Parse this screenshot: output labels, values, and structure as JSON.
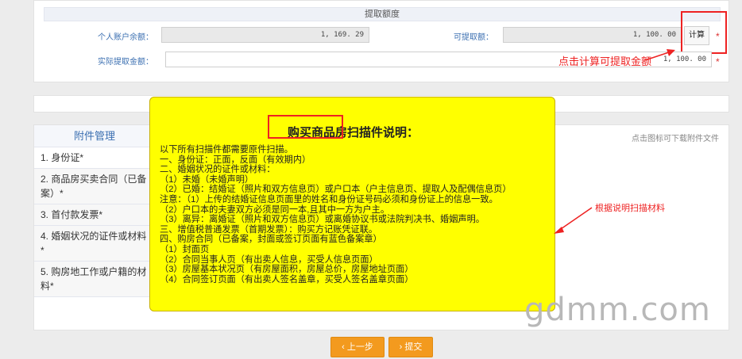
{
  "withdraw": {
    "section_title": "提取额度",
    "personal_balance_label": "个人账户余额：",
    "personal_balance_value": "1, 169. 29",
    "available_label": "可提取额：",
    "available_value": "1, 100. 00",
    "calc_button": "计算",
    "actual_label": "实际提取金额：",
    "actual_value": "1, 100. 00",
    "required_mark": "*"
  },
  "annotations": {
    "calc_note": "点击计算可提取金额",
    "scan_note": "根据说明扫描材料",
    "watermark": "gdmm.com",
    "accent_color": "#e22222"
  },
  "attachments": {
    "title": "附件管理",
    "download_hint": "点击图标可下载附件文件",
    "items": [
      {
        "label": "1. 身份证",
        "req": "*"
      },
      {
        "label": "2. 商品房买卖合同（已备案）",
        "req": "*"
      },
      {
        "label": "3. 首付款发票",
        "req": "*"
      },
      {
        "label": "4. 婚姻状况的证件或材料",
        "req": "*"
      },
      {
        "label": "5. 购房地工作或户籍的材料",
        "req": "*"
      }
    ]
  },
  "instructions": {
    "title": "购买商品房扫描件说明：",
    "lines": [
      "以下所有扫描件都需要原件扫描。",
      "一、身份证：正面，反面（有效期内）",
      "二、婚姻状况的证件或材料：",
      "（1）未婚（未婚声明）",
      "（2）已婚：结婚证（照片和双方信息页）或户口本（户主信息页、提取人及配偶信息页）",
      "注意：（1）上传的结婚证信息页面里的姓名和身份证号码必须和身份证上的信息一致。",
      "（2）户口本的夫妻双方必须是同一本,且其中一方为户主。",
      "（3）离异：离婚证（照片和双方信息页）或离婚协议书或法院判决书、婚姻声明。",
      "三、增值税普通发票（首期发票）：购买方记账凭证联。",
      "四、购房合同（已备案，封面或签订页面有蓝色备案章）",
      "（1）封面页",
      "（2）合同当事人页（有出卖人信息，买受人信息页面）",
      "（3）房屋基本状况页（有房屋面积，房屋总价，房屋地址页面）",
      "（4）合同签订页面（有出卖人签名盖章，买受人签名盖章页面）"
    ]
  },
  "actions": {
    "prev": "上一步",
    "submit": "提交",
    "button_color": "#f39a1e"
  }
}
